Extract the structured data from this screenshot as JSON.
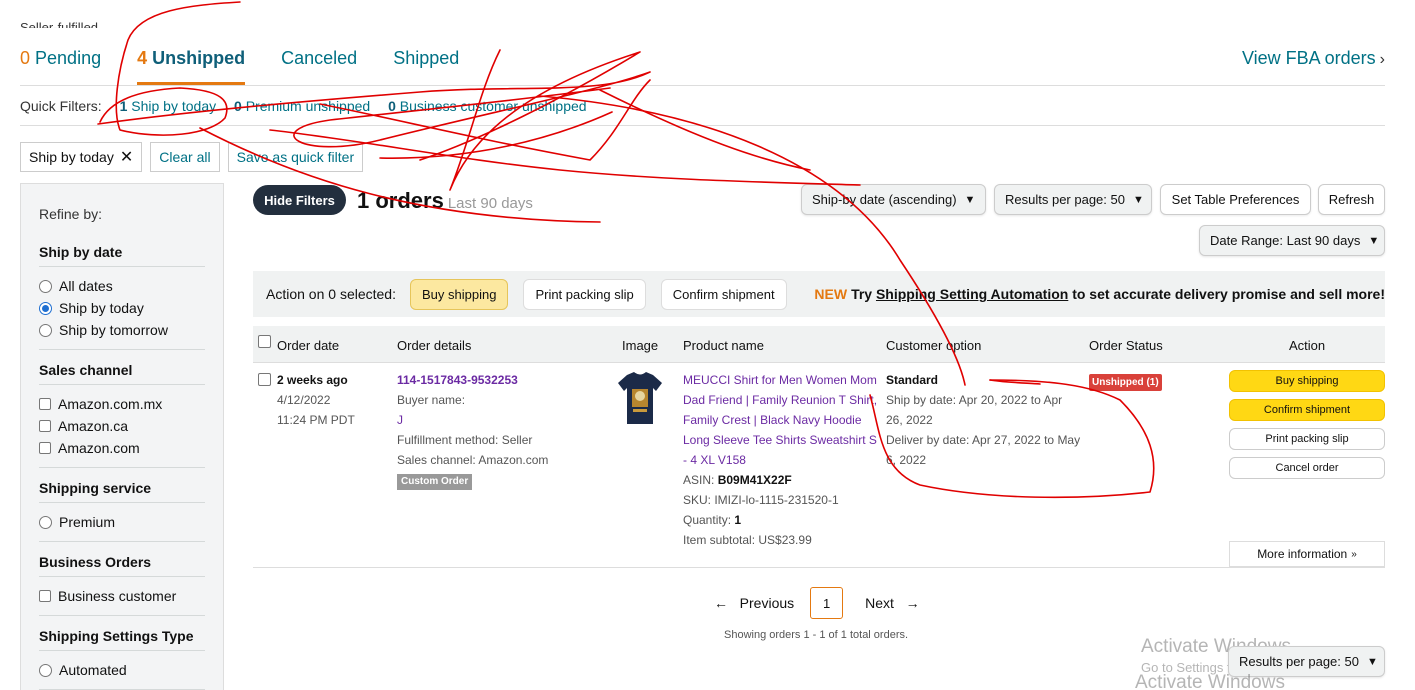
{
  "header": {
    "partial_title": "Seller-fulfilled"
  },
  "tabs": [
    {
      "count": "0",
      "label": "Pending"
    },
    {
      "count": "4",
      "label": "Unshipped"
    },
    {
      "label": "Canceled"
    },
    {
      "label": "Shipped"
    }
  ],
  "fba_link": "View FBA orders",
  "quick_filters": {
    "label": "Quick Filters:",
    "items": [
      {
        "count": "1",
        "label": "Ship by today"
      },
      {
        "count": "0",
        "label": "Premium unshipped"
      },
      {
        "count": "0",
        "label": "Business customer unshipped"
      }
    ]
  },
  "active_filters": {
    "chip": "Ship by today",
    "clear": "Clear all",
    "save": "Save as quick filter"
  },
  "sidebar": {
    "refine": "Refine by:",
    "sections": {
      "ship_by_date": {
        "title": "Ship by date",
        "options": [
          "All dates",
          "Ship by today",
          "Ship by tomorrow"
        ],
        "selected": "Ship by today"
      },
      "sales_channel": {
        "title": "Sales channel",
        "options": [
          "Amazon.com.mx",
          "Amazon.ca",
          "Amazon.com"
        ]
      },
      "shipping_service": {
        "title": "Shipping service",
        "options": [
          "Premium"
        ]
      },
      "business_orders": {
        "title": "Business Orders",
        "options": [
          "Business customer"
        ]
      },
      "shipping_settings_type": {
        "title": "Shipping Settings Type",
        "options": [
          "Automated"
        ]
      }
    }
  },
  "orders_header": {
    "hide_filters": "Hide Filters",
    "count": "1 orders",
    "range": "Last 90 days",
    "sort": "Ship-by date (ascending)",
    "per_page": "Results per page: 50",
    "table_prefs": "Set Table Preferences",
    "refresh": "Refresh",
    "date_range": "Date Range: Last 90 days"
  },
  "action_bar": {
    "label": "Action on 0 selected:",
    "buy": "Buy shipping",
    "print": "Print packing slip",
    "confirm": "Confirm shipment",
    "promo_new": "NEW",
    "promo_try": "Try",
    "promo_link": "Shipping Setting Automation",
    "promo_rest": "to set accurate delivery promise and sell more!"
  },
  "table": {
    "columns": [
      "Order date",
      "Order details",
      "Image",
      "Product name",
      "Customer option",
      "Order Status",
      "Action"
    ],
    "row": {
      "age": "2 weeks ago",
      "date": "4/12/2022",
      "time": "11:24 PM PDT",
      "order_id": "114-1517843-9532253",
      "buyer_label": "Buyer name:",
      "buyer": "J",
      "fulfillment": "Fulfillment method: Seller",
      "channel": "Sales channel: Amazon.com",
      "custom_badge": "Custom Order",
      "product_lines": [
        "MEUCCI Shirt for Men Women Mom",
        "Dad Friend | Family Reunion T Shirt,",
        "Family Crest | Black Navy Hoodie",
        "Long Sleeve Tee Shirts Sweatshirt S",
        "- 4 XL V158"
      ],
      "asin_label": "ASIN:",
      "asin": "B09M41X22F",
      "sku": "SKU: IMIZI-lo-1115-231520-1",
      "qty_label": "Quantity:",
      "qty": "1",
      "subtotal": "Item subtotal: US$23.99",
      "option": "Standard",
      "ship_by_1": "Ship by date: Apr 20, 2022 to Apr",
      "ship_by_2": "26, 2022",
      "deliver_by_1": "Deliver by date: Apr 27, 2022 to May",
      "deliver_by_2": "6, 2022",
      "status": "Unshipped (1)",
      "actions": {
        "buy": "Buy shipping",
        "confirm": "Confirm shipment",
        "print": "Print packing slip",
        "cancel": "Cancel order",
        "more": "More information"
      }
    }
  },
  "pagination": {
    "prev": "Previous",
    "page": "1",
    "next": "Next",
    "showing": "Showing orders 1 - 1 of 1 total orders.",
    "per_page": "Results per page: 50"
  },
  "watermark": {
    "line1": "Activate Windows",
    "line2": "Go to Settings to activate Windows.",
    "line3": "Activate Windows"
  },
  "colors": {
    "accent": "#e47911",
    "link": "#007185",
    "annotation": "#e00000"
  }
}
